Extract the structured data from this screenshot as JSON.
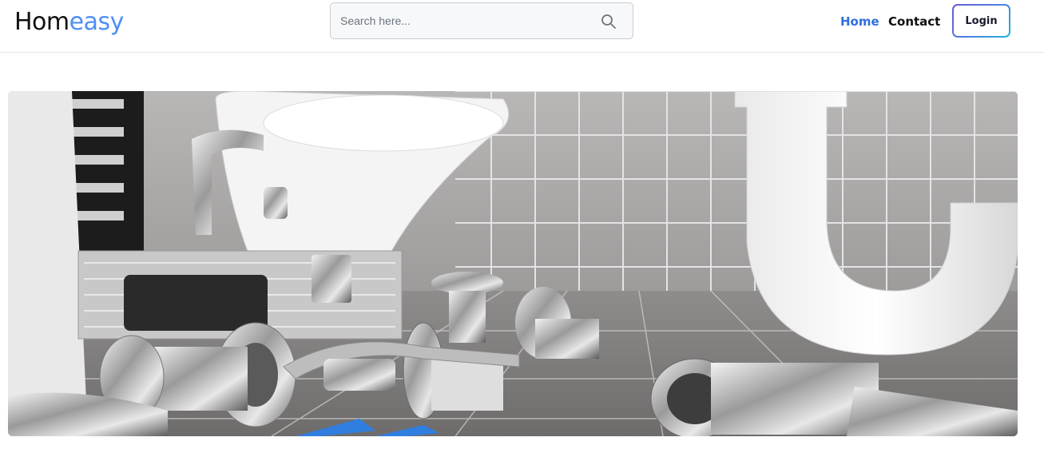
{
  "brand": {
    "prefix": "Hom",
    "accent": "easy",
    "accent_color": "#4f8ef7"
  },
  "search": {
    "placeholder": "Search here...",
    "icon": "search-icon"
  },
  "nav": {
    "home_label": "Home",
    "contact_label": "Contact",
    "active_color": "#2f6fe0"
  },
  "login": {
    "label": "Login"
  },
  "hero": {
    "image": "bathroom plumbing tools photo"
  }
}
